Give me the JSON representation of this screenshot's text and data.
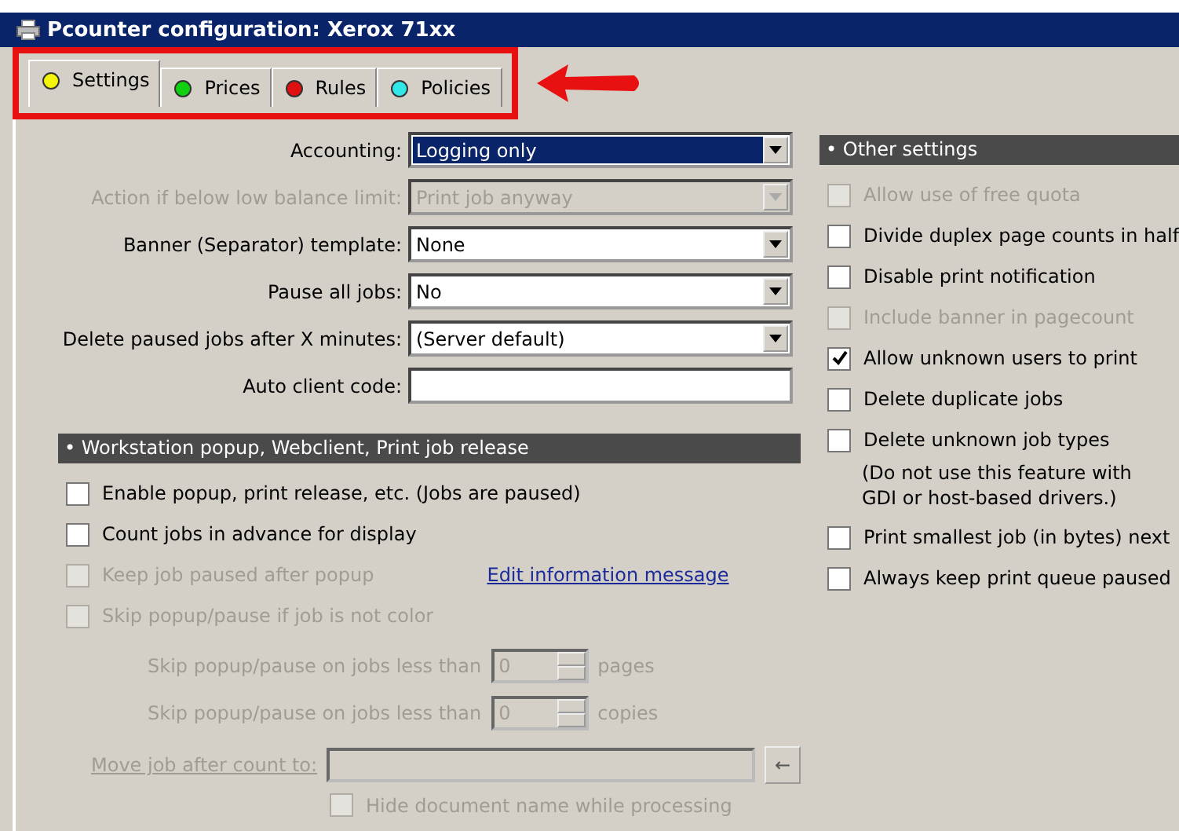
{
  "window": {
    "title": "Pcounter configuration: Xerox 71xx"
  },
  "tabs": [
    {
      "label": "Settings",
      "color": "#f5f50a",
      "selected": true
    },
    {
      "label": "Prices",
      "color": "#10d010",
      "selected": false
    },
    {
      "label": "Rules",
      "color": "#e01010",
      "selected": false
    },
    {
      "label": "Policies",
      "color": "#30e8e8",
      "selected": false
    }
  ],
  "fields": [
    {
      "kind": "dropdown",
      "label": "Accounting:",
      "value": "Logging only",
      "disabled": false,
      "focused": true
    },
    {
      "kind": "dropdown",
      "label": "Action if below low balance limit:",
      "value": "Print job anyway",
      "disabled": true,
      "focused": false
    },
    {
      "kind": "dropdown",
      "label": "Banner (Separator) template:",
      "value": "None",
      "disabled": false,
      "focused": false
    },
    {
      "kind": "dropdown",
      "label": "Pause all jobs:",
      "value": "No",
      "disabled": false,
      "focused": false
    },
    {
      "kind": "dropdown",
      "label": "Delete paused jobs after X minutes:",
      "value": "(Server default)",
      "disabled": false,
      "focused": false
    },
    {
      "kind": "text",
      "label": "Auto client code:"
    }
  ],
  "popup_section": {
    "title": "• Workstation popup, Webclient, Print job release",
    "options": [
      {
        "label": "Enable popup, print release, etc. (Jobs are paused)",
        "checked": false,
        "disabled": false
      },
      {
        "label": "Count jobs in advance for display",
        "checked": false,
        "disabled": false
      },
      {
        "label": "Keep job paused after popup",
        "checked": false,
        "disabled": true
      },
      {
        "label": "Skip popup/pause if job is not color",
        "checked": false,
        "disabled": true
      }
    ],
    "link": "Edit information message",
    "spin_rows": [
      {
        "label": "Skip popup/pause on jobs less than",
        "value": "0",
        "unit": "pages"
      },
      {
        "label": "Skip popup/pause on jobs less than",
        "value": "0",
        "unit": "copies"
      }
    ],
    "move_job": {
      "label": "Move job after count to:",
      "button": "←"
    },
    "hide_option": {
      "label": "Hide document name while processing",
      "checked": false,
      "disabled": true
    }
  },
  "other_settings": {
    "title": "• Other settings",
    "options": [
      {
        "label": "Allow use of free quota",
        "checked": false,
        "disabled": true
      },
      {
        "label": "Divide duplex page counts in half",
        "checked": false,
        "disabled": false
      },
      {
        "label": "Disable print notification",
        "checked": false,
        "disabled": false
      },
      {
        "label": "Include banner in pagecount",
        "checked": false,
        "disabled": true
      },
      {
        "label": "Allow unknown users to print",
        "checked": true,
        "disabled": false
      },
      {
        "label": "Delete duplicate jobs",
        "checked": false,
        "disabled": false
      },
      {
        "label": "Delete unknown job types",
        "checked": false,
        "disabled": false,
        "note": "(Do not use this feature with GDI or host-based drivers.)"
      },
      {
        "label": "Print smallest job (in bytes) next",
        "checked": false,
        "disabled": false
      },
      {
        "label": "Always keep print queue paused",
        "checked": false,
        "disabled": false
      }
    ]
  }
}
